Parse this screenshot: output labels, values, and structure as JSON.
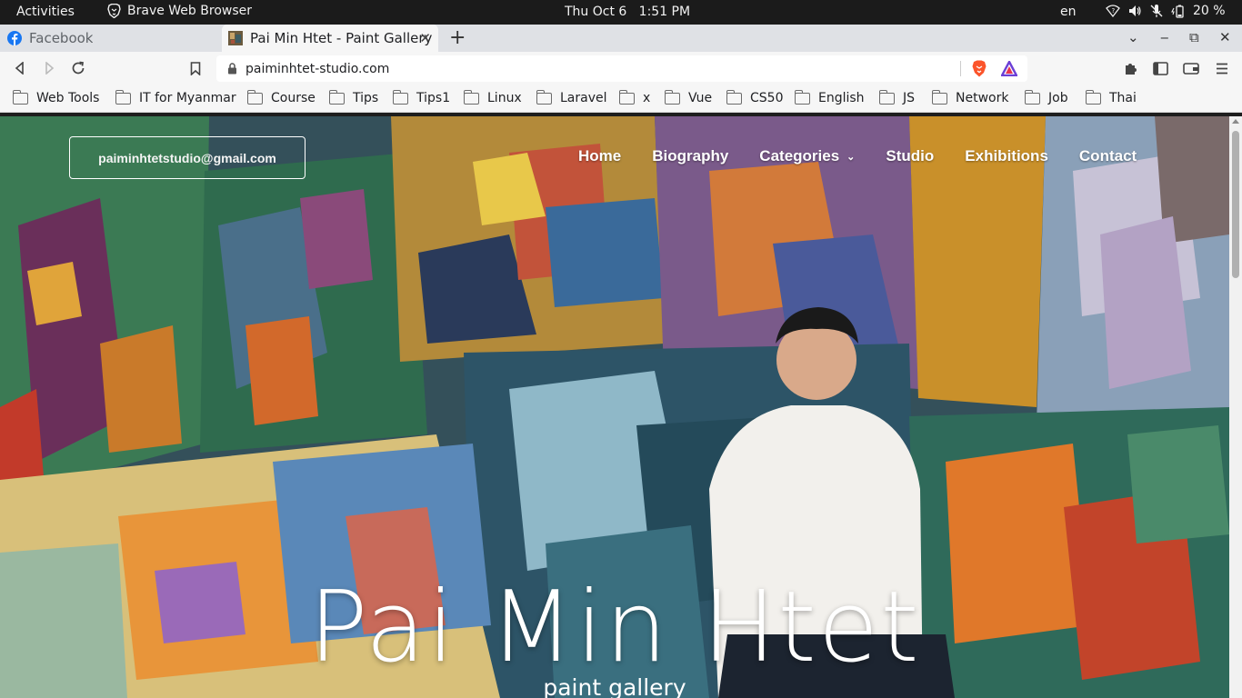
{
  "system_bar": {
    "activities": "Activities",
    "app_name": "Brave Web Browser",
    "clock": "Thu Oct 6   1:51 PM",
    "language": "en",
    "battery": "20 %"
  },
  "browser": {
    "tabs": [
      {
        "title": "Facebook",
        "active": false
      },
      {
        "title": "Pai Min Htet - Paint Gallery",
        "active": true
      }
    ],
    "url": "paiminhtet-studio.com",
    "bookmarks": [
      "Web Tools",
      "IT for Myanmar",
      "Course",
      "Tips",
      "Tips1",
      "Linux",
      "Laravel",
      "x",
      "Vue",
      "CS50",
      "English",
      "JS",
      "Network",
      "Job",
      "Thai"
    ]
  },
  "site": {
    "email": "paiminhtetstudio@gmail.com",
    "nav": [
      "Home",
      "Biography",
      "Categories",
      "Studio",
      "Exhibitions",
      "Contact"
    ],
    "hero_title": "Pai Min Htet",
    "hero_subtitle": "paint gallery"
  },
  "colors": {
    "topbar": "#1b1b1b",
    "chrome": "#f6f6f6",
    "tabstrip": "#dfe1e5",
    "brave_orange": "#fb542b",
    "facebook_blue": "#1877f2"
  }
}
